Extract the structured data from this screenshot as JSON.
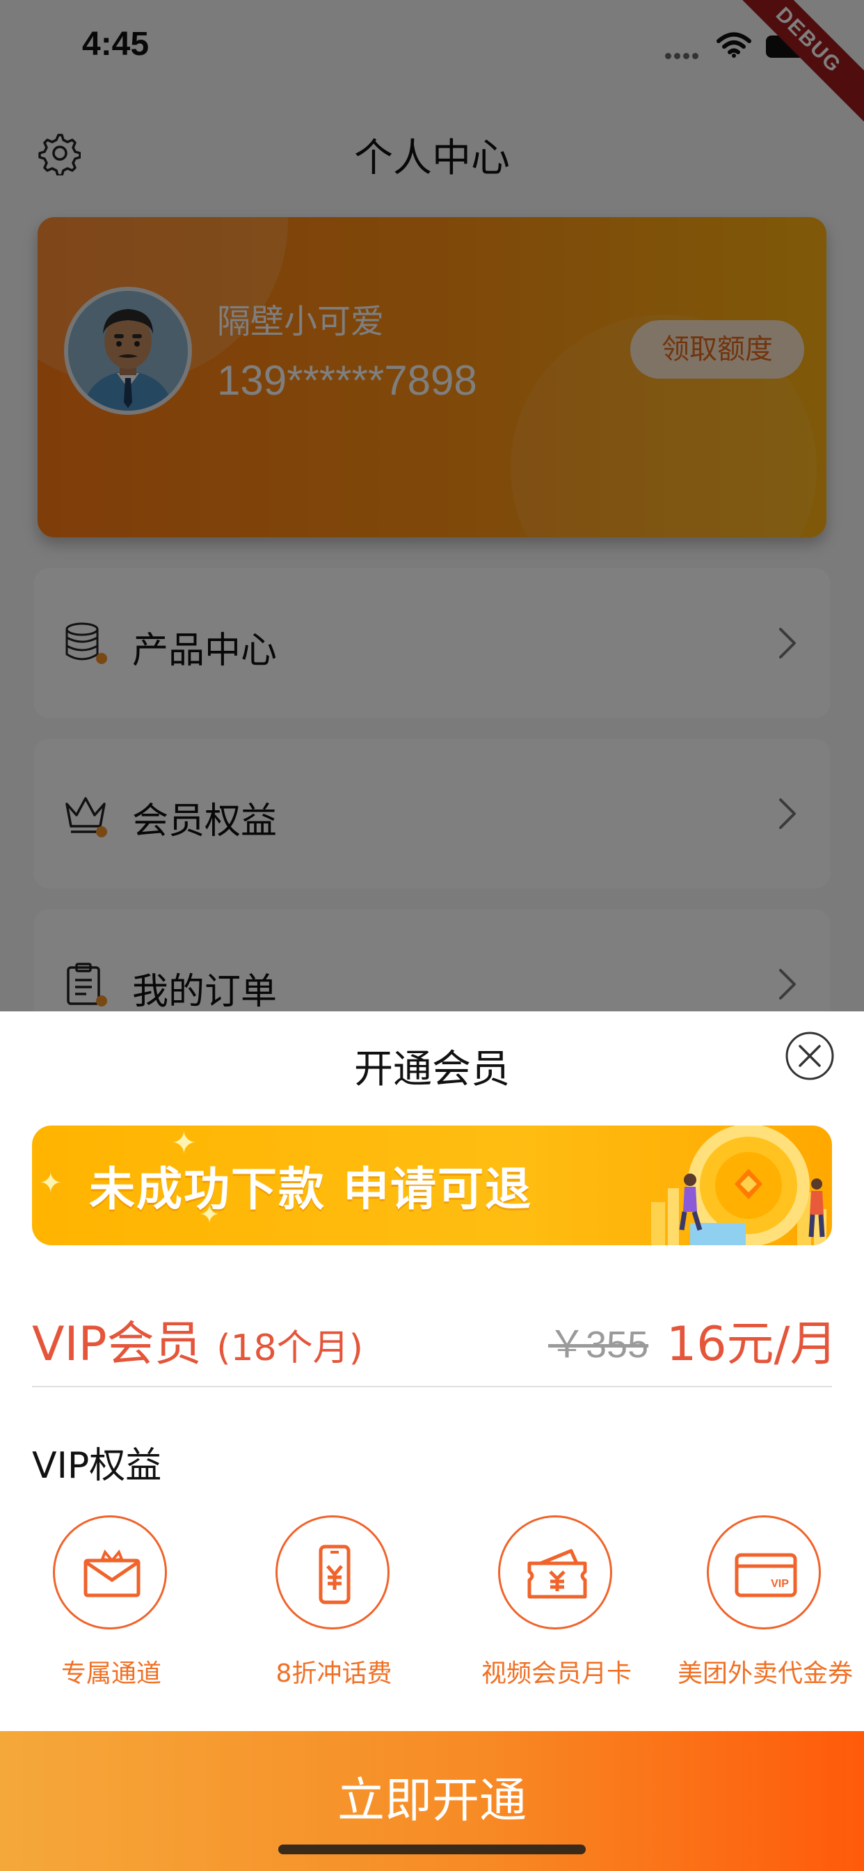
{
  "status_bar": {
    "time": "4:45"
  },
  "debug_banner": "DEBUG",
  "header": {
    "title": "个人中心",
    "settings_icon": "gear-icon"
  },
  "profile": {
    "name": "隔壁小可爱",
    "phone": "139******7898",
    "claim_button": "领取额度"
  },
  "menu": [
    {
      "label": "产品中心",
      "icon": "database-icon"
    },
    {
      "label": "会员权益",
      "icon": "crown-icon"
    },
    {
      "label": "我的订单",
      "icon": "clipboard-icon"
    }
  ],
  "sheet": {
    "title": "开通会员",
    "banner_text": "未成功下款 申请可退",
    "vip_name": "VIP会员",
    "vip_period": "(18个月)",
    "price_original": "￥355",
    "price_current": "16元/月",
    "benefits_title": "VIP权益",
    "benefits": [
      {
        "label": "专属通道",
        "icon": "gift-envelope-icon"
      },
      {
        "label": "8折冲话费",
        "icon": "phone-yuan-icon"
      },
      {
        "label": "视频会员月卡",
        "icon": "ticket-yuan-icon"
      },
      {
        "label": "美团外卖代金券",
        "icon": "vip-card-icon"
      }
    ],
    "cta": "立即开通"
  },
  "colors": {
    "accent": "#e4553a",
    "orange": "#f07024",
    "card_start": "#ff7a14",
    "card_end": "#ffb312"
  }
}
